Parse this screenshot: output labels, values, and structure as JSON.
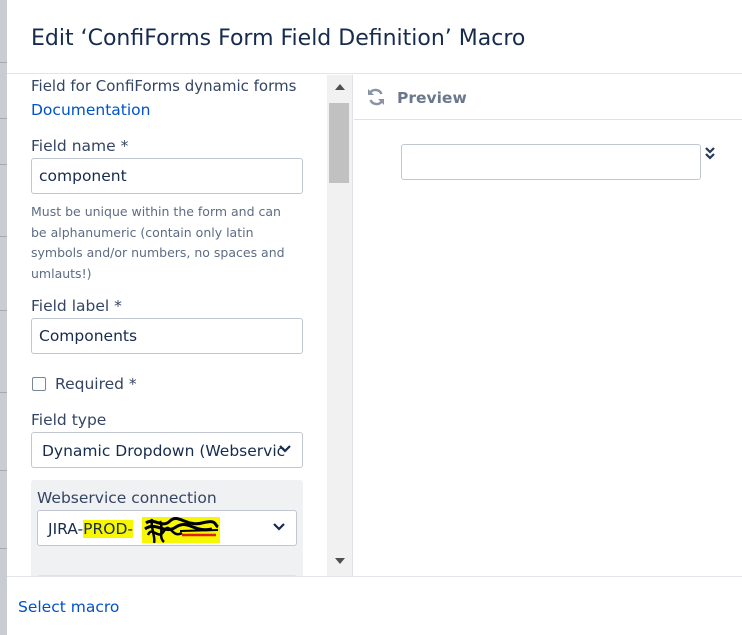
{
  "dialog": {
    "title": "Edit ‘ConfiForms Form Field Definition’ Macro"
  },
  "form": {
    "description": "Field for ConfiForms dynamic forms",
    "documentation_link": "Documentation",
    "field_name": {
      "label": "Field name *",
      "value": "component",
      "help_lines": [
        "Must be unique within the form and can",
        "be alphanumeric (contain only latin",
        "symbols and/or numbers, no spaces and",
        "umlauts!)"
      ]
    },
    "field_label": {
      "label": "Field label *",
      "value": "Components"
    },
    "required": {
      "label": "Required *",
      "checked": false
    },
    "field_type": {
      "label": "Field type",
      "selected": "Dynamic Dropdown (Webservic"
    },
    "webservice": {
      "label": "Webservice connection",
      "selected_prefix": "JIRA-",
      "selected_highlighted": "PROD-",
      "highlight_color": "#f7f700"
    }
  },
  "preview": {
    "title": "Preview",
    "refresh_icon": "refresh-icon",
    "expand_icon": "double-chevron-down-icon"
  },
  "footer": {
    "select_macro_link": "Select macro"
  },
  "colors": {
    "link": "#0052cc",
    "text": "#172b4d",
    "border": "#c1c7d0"
  }
}
